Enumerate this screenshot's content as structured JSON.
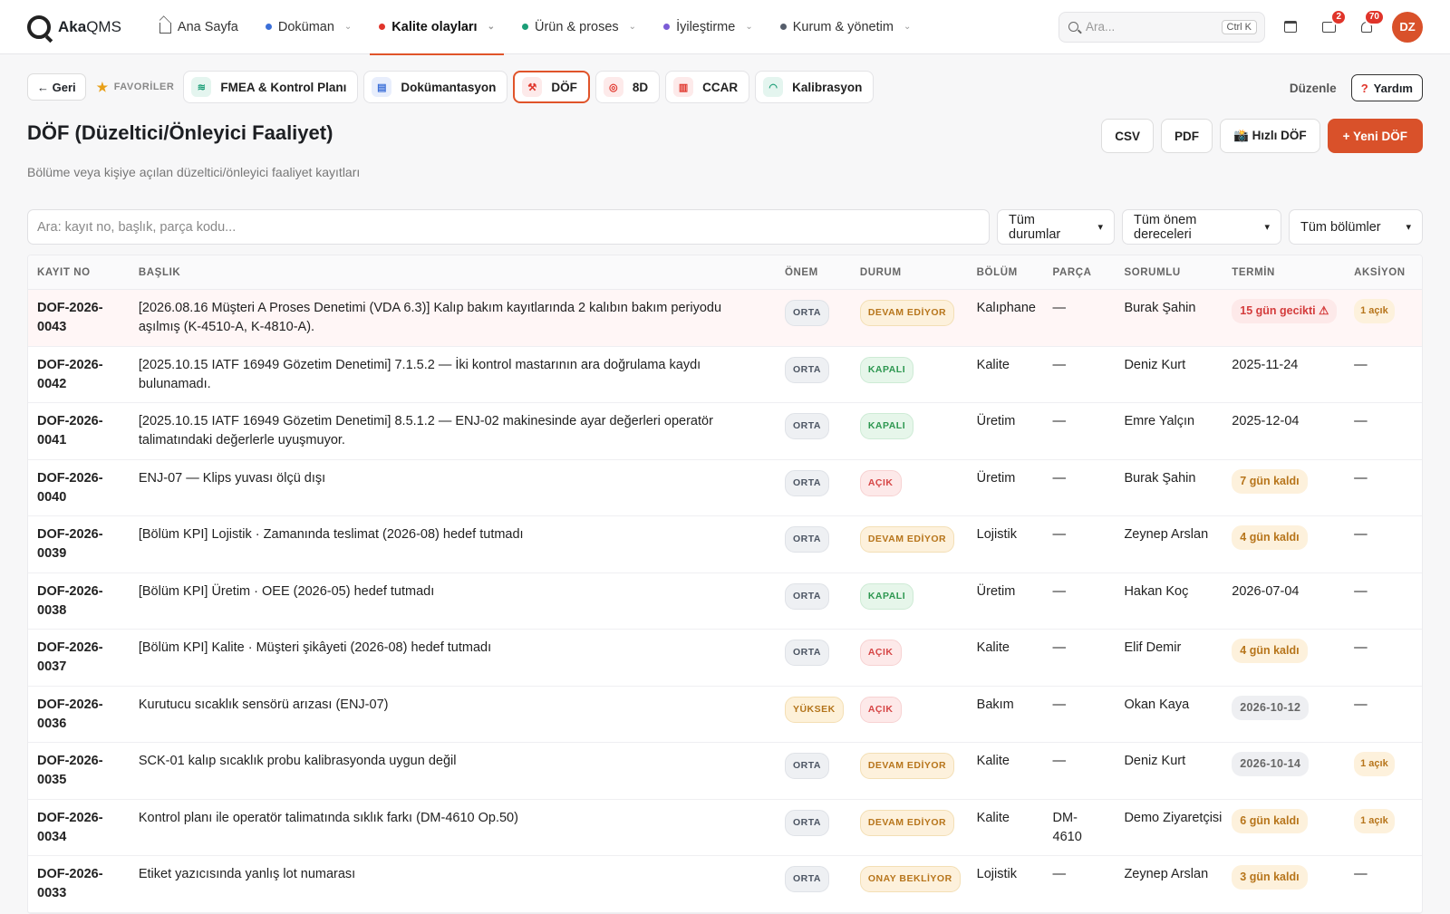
{
  "brand": {
    "name_bold": "Aka",
    "name_rest": "QMS"
  },
  "nav": [
    {
      "label": "Ana Sayfa",
      "icon": "home-icon",
      "dot": null,
      "chevron": false,
      "active": false
    },
    {
      "label": "Doküman",
      "dot": "#3b6fd8",
      "chevron": true,
      "active": false
    },
    {
      "label": "Kalite olayları",
      "dot": "#e0342a",
      "chevron": true,
      "active": true
    },
    {
      "label": "Ürün & proses",
      "dot": "#1b9e77",
      "chevron": true,
      "active": false
    },
    {
      "label": "İyileştirme",
      "dot": "#7b5cd6",
      "chevron": true,
      "active": false
    },
    {
      "label": "Kurum & yönetim",
      "dot": "#555d6b",
      "chevron": true,
      "active": false
    }
  ],
  "search": {
    "placeholder": "Ara...",
    "shortcut": "Ctrl K"
  },
  "notifications": {
    "inbox_count": "2",
    "bell_count": "70"
  },
  "user": {
    "initials": "DZ"
  },
  "favbar": {
    "back_label": "← Geri",
    "favorites_label": "FAVORİLER",
    "items": [
      {
        "label": "FMEA & Kontrol Planı",
        "icon": "layers-icon",
        "bg": "#e4f5ef",
        "fg": "#1b9e77",
        "glyph": "≋",
        "active": false
      },
      {
        "label": "Dokümantasyon",
        "icon": "document-icon",
        "bg": "#e8eefc",
        "fg": "#3b6fd8",
        "glyph": "▤",
        "active": false
      },
      {
        "label": "DÖF",
        "icon": "wrench-icon",
        "bg": "#fdeaea",
        "fg": "#e0342a",
        "glyph": "⚒",
        "active": true
      },
      {
        "label": "8D",
        "icon": "target-icon",
        "bg": "#fdeaea",
        "fg": "#e0342a",
        "glyph": "◎",
        "active": false
      },
      {
        "label": "CCAR",
        "icon": "clipboard-icon",
        "bg": "#fdeaea",
        "fg": "#e0342a",
        "glyph": "▥",
        "active": false
      },
      {
        "label": "Kalibrasyon",
        "icon": "gauge-icon",
        "bg": "#e4f5ef",
        "fg": "#1b9e77",
        "glyph": "◠",
        "active": false
      }
    ],
    "edit_label": "Düzenle",
    "help_label": "Yardım"
  },
  "page": {
    "title": "DÖF (Düzeltici/Önleyici Faaliyet)",
    "subtitle": "Bölüme veya kişiye açılan düzeltici/önleyici faaliyet kayıtları",
    "actions": {
      "csv": "CSV",
      "pdf": "PDF",
      "quick": "📸 Hızlı DÖF",
      "new": "+ Yeni DÖF"
    }
  },
  "filters": {
    "search_placeholder": "Ara: kayıt no, başlık, parça kodu...",
    "status": "Tüm durumlar",
    "severity": "Tüm önem dereceleri",
    "department": "Tüm bölümler"
  },
  "table": {
    "columns": [
      "KAYIT NO",
      "BAŞLIK",
      "ÖNEM",
      "DURUM",
      "BÖLÜM",
      "PARÇA",
      "SORUMLU",
      "TERMİN",
      "AKSİYON"
    ],
    "rows": [
      {
        "id": "DOF-2026-0043",
        "title": "[2026.08.16 Müşteri A Proses Denetimi (VDA 6.3)] Kalıp bakım kayıtlarında 2 kalıbın bakım periyodu aşılmış (K-4510-A, K-4810-A).",
        "severity": "ORTA",
        "sev": "orta",
        "status": "DEVAM EDİYOR",
        "st": "devam",
        "dept": "Kalıphane",
        "part": "—",
        "owner": "Burak Şahin",
        "due": "15 gün gecikti ⚠",
        "due_type": "late",
        "action": "1 açık",
        "late": true
      },
      {
        "id": "DOF-2026-0042",
        "title": "[2025.10.15 IATF 16949 Gözetim Denetimi] 7.1.5.2 — İki kontrol mastarının ara doğrulama kaydı bulunamadı.",
        "severity": "ORTA",
        "sev": "orta",
        "status": "KAPALI",
        "st": "kapali",
        "dept": "Kalite",
        "part": "—",
        "owner": "Deniz Kurt",
        "due": "2025-11-24",
        "due_type": "plain",
        "action": "—",
        "late": false
      },
      {
        "id": "DOF-2026-0041",
        "title": "[2025.10.15 IATF 16949 Gözetim Denetimi] 8.5.1.2 — ENJ-02 makinesinde ayar değerleri operatör talimatındaki değerlerle uyuşmuyor.",
        "severity": "ORTA",
        "sev": "orta",
        "status": "KAPALI",
        "st": "kapali",
        "dept": "Üretim",
        "part": "—",
        "owner": "Emre Yalçın",
        "due": "2025-12-04",
        "due_type": "plain",
        "action": "—",
        "late": false
      },
      {
        "id": "DOF-2026-0040",
        "title": "ENJ-07 — Klips yuvası ölçü dışı",
        "severity": "ORTA",
        "sev": "orta",
        "status": "AÇIK",
        "st": "acik",
        "dept": "Üretim",
        "part": "—",
        "owner": "Burak Şahin",
        "due": "7 gün kaldı",
        "due_type": "warn",
        "action": "—",
        "late": false
      },
      {
        "id": "DOF-2026-0039",
        "title": "[Bölüm KPI] Lojistik · Zamanında teslimat (2026-08) hedef tutmadı",
        "severity": "ORTA",
        "sev": "orta",
        "status": "DEVAM EDİYOR",
        "st": "devam",
        "dept": "Lojistik",
        "part": "—",
        "owner": "Zeynep Arslan",
        "due": "4 gün kaldı",
        "due_type": "warn",
        "action": "—",
        "late": false
      },
      {
        "id": "DOF-2026-0038",
        "title": "[Bölüm KPI] Üretim · OEE (2026-05) hedef tutmadı",
        "severity": "ORTA",
        "sev": "orta",
        "status": "KAPALI",
        "st": "kapali",
        "dept": "Üretim",
        "part": "—",
        "owner": "Hakan Koç",
        "due": "2026-07-04",
        "due_type": "plain",
        "action": "—",
        "late": false
      },
      {
        "id": "DOF-2026-0037",
        "title": "[Bölüm KPI] Kalite · Müşteri şikâyeti (2026-08) hedef tutmadı",
        "severity": "ORTA",
        "sev": "orta",
        "status": "AÇIK",
        "st": "acik",
        "dept": "Kalite",
        "part": "—",
        "owner": "Elif Demir",
        "due": "4 gün kaldı",
        "due_type": "warn",
        "action": "—",
        "late": false
      },
      {
        "id": "DOF-2026-0036",
        "title": "Kurutucu sıcaklık sensörü arızası (ENJ-07)",
        "severity": "YÜKSEK",
        "sev": "yuksek",
        "status": "AÇIK",
        "st": "acik",
        "dept": "Bakım",
        "part": "—",
        "owner": "Okan Kaya",
        "due": "2026-10-12",
        "due_type": "gray",
        "action": "—",
        "late": false
      },
      {
        "id": "DOF-2026-0035",
        "title": "SCK-01 kalıp sıcaklık probu kalibrasyonda uygun değil",
        "severity": "ORTA",
        "sev": "orta",
        "status": "DEVAM EDİYOR",
        "st": "devam",
        "dept": "Kalite",
        "part": "—",
        "owner": "Deniz Kurt",
        "due": "2026-10-14",
        "due_type": "gray",
        "action": "1 açık",
        "late": false
      },
      {
        "id": "DOF-2026-0034",
        "title": "Kontrol planı ile operatör talimatında sıklık farkı (DM-4610 Op.50)",
        "severity": "ORTA",
        "sev": "orta",
        "status": "DEVAM EDİYOR",
        "st": "devam",
        "dept": "Kalite",
        "part": "DM-4610",
        "owner": "Demo Ziyaretçisi",
        "due": "6 gün kaldı",
        "due_type": "warn",
        "action": "1 açık",
        "late": false
      },
      {
        "id": "DOF-2026-0033",
        "title": "Etiket yazıcısında yanlış lot numarası",
        "severity": "ORTA",
        "sev": "orta",
        "status": "ONAY BEKLİYOR",
        "st": "onay",
        "dept": "Lojistik",
        "part": "—",
        "owner": "Zeynep Arslan",
        "due": "3 gün kaldı",
        "due_type": "warn",
        "action": "—",
        "late": false
      }
    ]
  }
}
